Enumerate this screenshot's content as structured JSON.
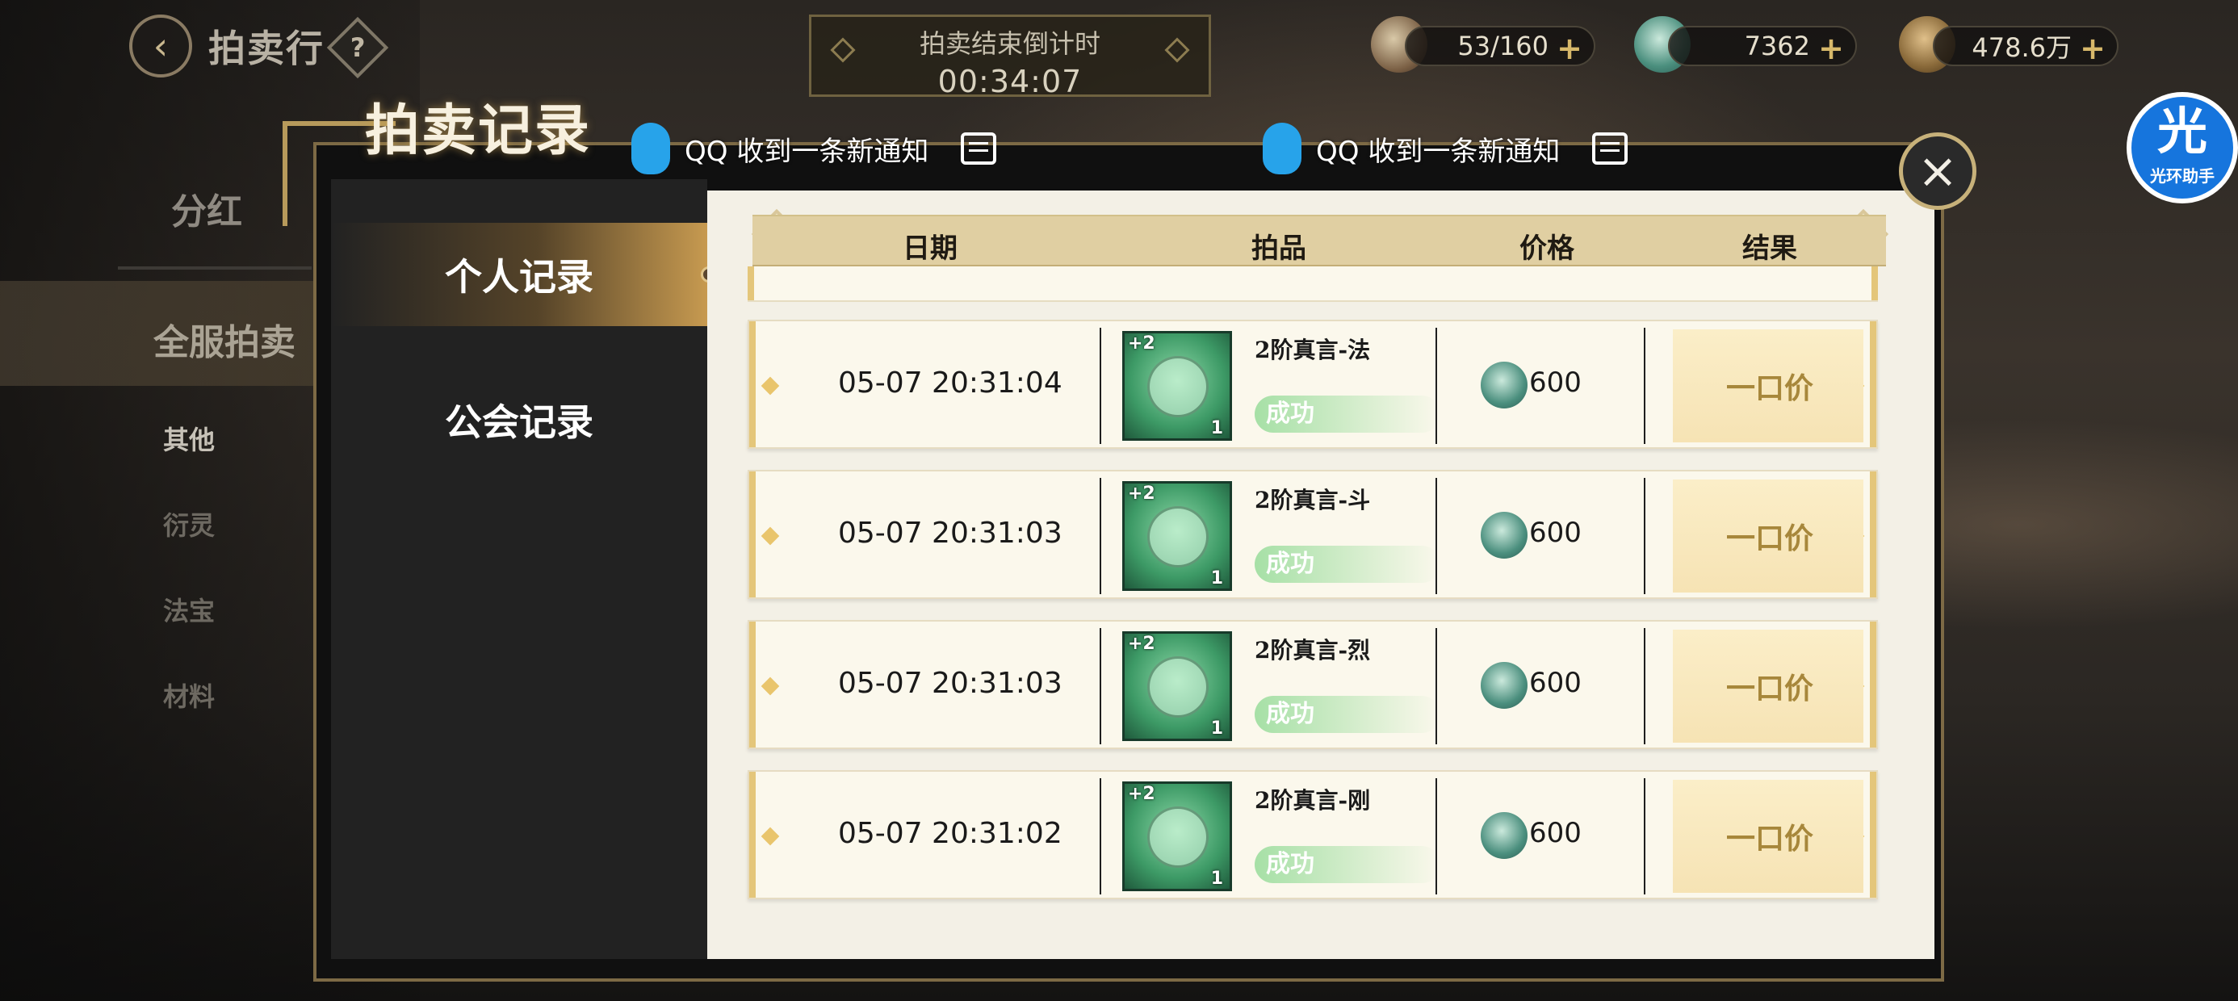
{
  "header": {
    "back_icon": "back-arrow-icon",
    "title": "拍卖行",
    "help": "?"
  },
  "sidebar": {
    "fenhong": "分红",
    "quanfu": "全服拍卖",
    "items": [
      "其他",
      "衍灵",
      "法宝",
      "材料"
    ]
  },
  "countdown": {
    "label": "拍卖结束倒计时",
    "time": "00:34:07"
  },
  "currencies": [
    {
      "icon": "stamina-icon",
      "value": "53/160"
    },
    {
      "icon": "jade-icon",
      "value": "7362"
    },
    {
      "icon": "coin-icon",
      "value": "478.6万"
    }
  ],
  "notifications": [
    {
      "text": "QQ 收到一条新通知"
    },
    {
      "text": "QQ 收到一条新通知"
    }
  ],
  "helper": {
    "big": "光",
    "small": "光环助手"
  },
  "dialog": {
    "title": "拍卖记录",
    "close": "×",
    "tabs": [
      {
        "label": "个人记录",
        "active": true
      },
      {
        "label": "公会记录",
        "active": false
      }
    ],
    "columns": [
      "日期",
      "拍品",
      "价格",
      "结果"
    ],
    "rows": [
      {
        "date": "05-07 20:31:04",
        "level": "+2",
        "qty": "1",
        "name": "2阶真言-法",
        "status": "成功",
        "price": "600",
        "result": "一口价"
      },
      {
        "date": "05-07 20:31:03",
        "level": "+2",
        "qty": "1",
        "name": "2阶真言-斗",
        "status": "成功",
        "price": "600",
        "result": "一口价"
      },
      {
        "date": "05-07 20:31:03",
        "level": "+2",
        "qty": "1",
        "name": "2阶真言-烈",
        "status": "成功",
        "price": "600",
        "result": "一口价"
      },
      {
        "date": "05-07 20:31:02",
        "level": "+2",
        "qty": "1",
        "name": "2阶真言-刚",
        "status": "成功",
        "price": "600",
        "result": "一口价"
      }
    ]
  },
  "colors": {
    "accent_gold": "#c79a50",
    "status_green": "#a6e0a6",
    "result_gold": "#a7873b"
  }
}
